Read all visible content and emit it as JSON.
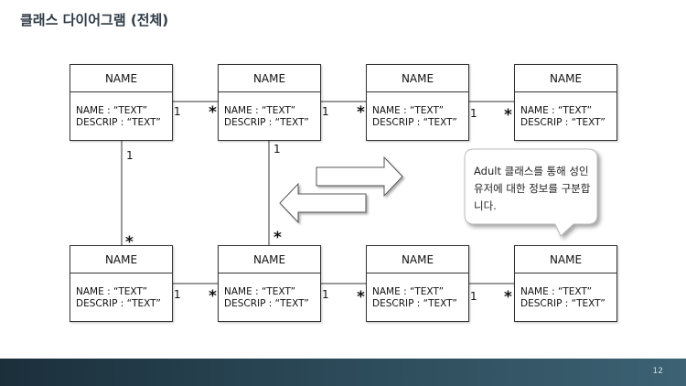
{
  "title": "클래스 다이어그램 (전체)",
  "classes": [
    {
      "name": "NAME",
      "attr1": "NAME : “TEXT”",
      "attr2": "DESCRIP : “TEXT”"
    },
    {
      "name": "NAME",
      "attr1": "NAME : “TEXT”",
      "attr2": "DESCRIP : “TEXT”"
    },
    {
      "name": "NAME",
      "attr1": "NAME : “TEXT”",
      "attr2": "DESCRIP : “TEXT”"
    },
    {
      "name": "NAME",
      "attr1": "NAME : “TEXT”",
      "attr2": "DESCRIP : “TEXT”"
    },
    {
      "name": "NAME",
      "attr1": "NAME : “TEXT”",
      "attr2": "DESCRIP : “TEXT”"
    },
    {
      "name": "NAME",
      "attr1": "NAME : “TEXT”",
      "attr2": "DESCRIP : “TEXT”"
    },
    {
      "name": "NAME",
      "attr1": "NAME : “TEXT”",
      "attr2": "DESCRIP : “TEXT”"
    },
    {
      "name": "NAME",
      "attr1": "NAME : “TEXT”",
      "attr2": "DESCRIP : “TEXT”"
    }
  ],
  "multiplicity": {
    "one": "1",
    "many": "*"
  },
  "callout": {
    "text": "Adult 클래스를 통해 성인 유저에 대한 정보를 구분합니다."
  },
  "page_number": "12"
}
